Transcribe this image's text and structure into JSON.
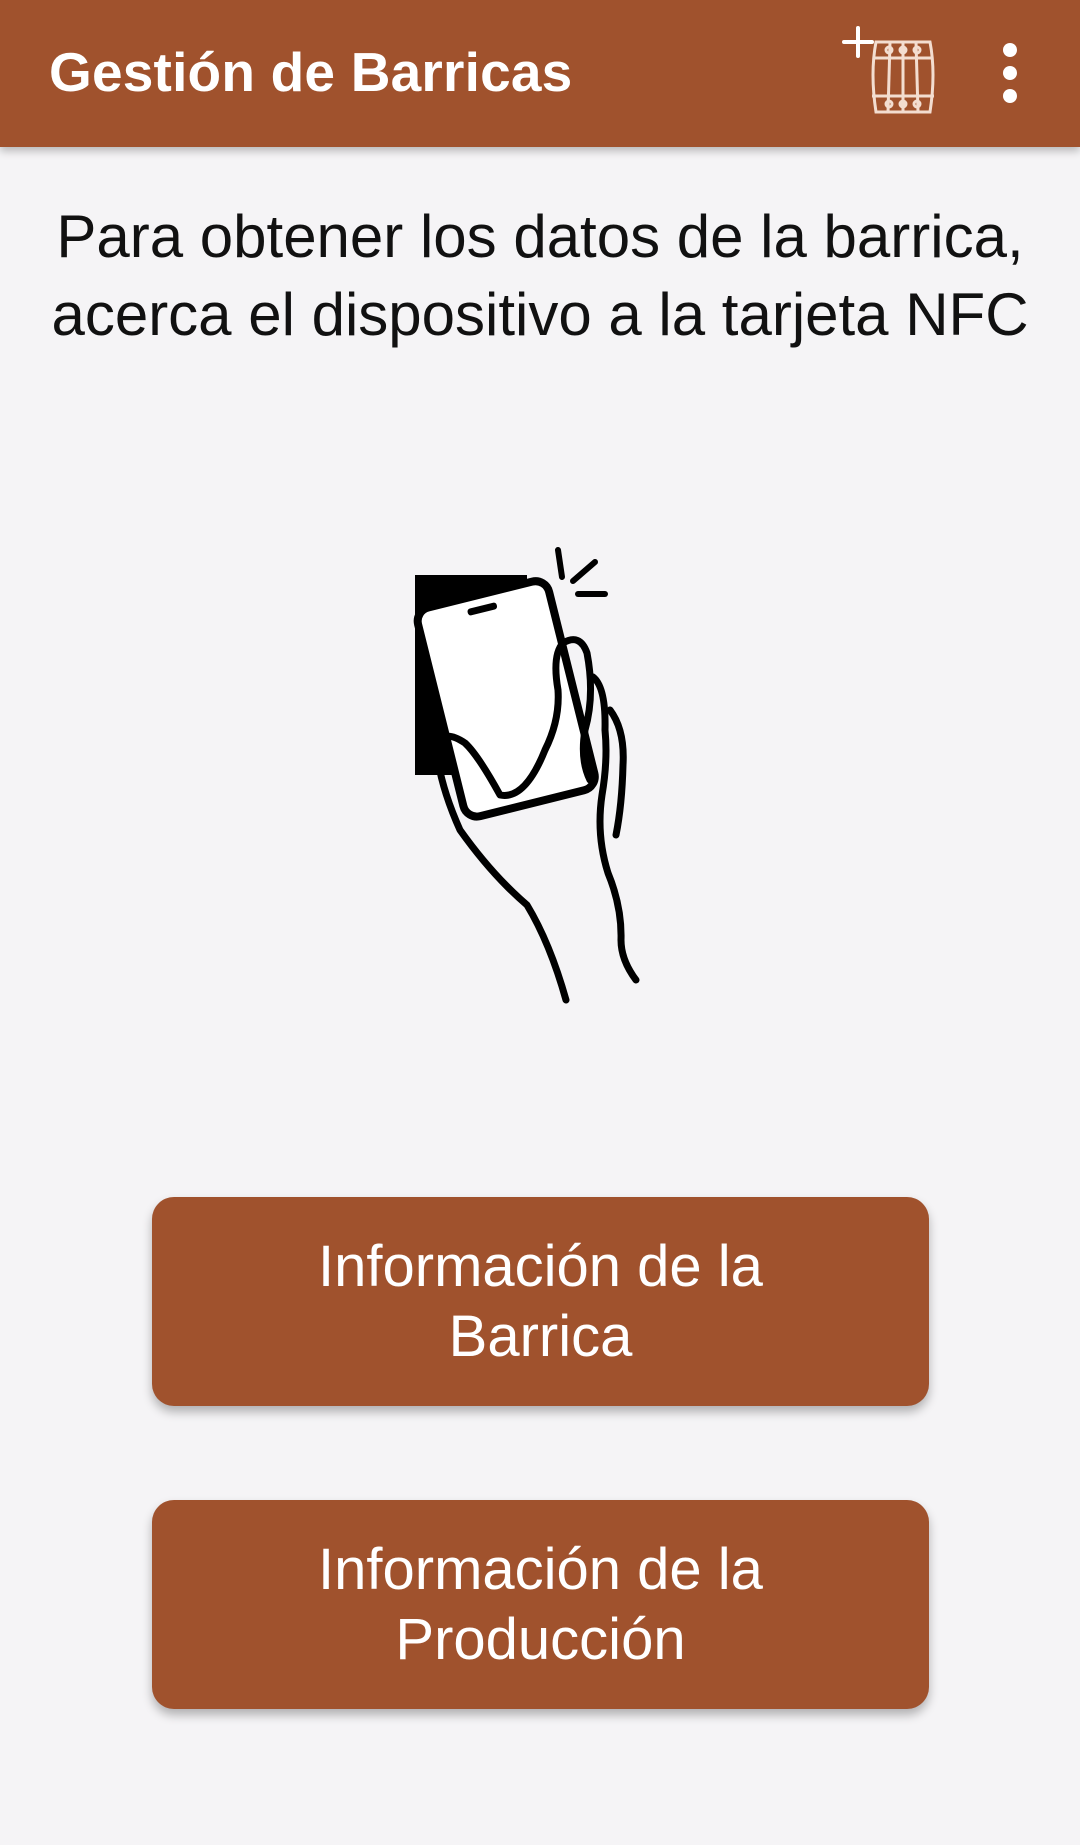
{
  "app_bar": {
    "title": "Gestión de Barricas",
    "add_button_icon": "add-barrel-icon",
    "overflow_icon": "more-vert-icon"
  },
  "instruction_text": "Para obtener los datos de la barrica, acerca el dispositivo a la tarjeta NFC",
  "illustration_icon": "nfc-tap-phone-icon",
  "buttons": {
    "barrel_info": "Información de la Barrica",
    "production_info": "Información de la Producción"
  },
  "colors": {
    "primary": "#a0522d",
    "background": "#f5f4f6",
    "text": "#111111",
    "on_primary": "#ffffff"
  }
}
